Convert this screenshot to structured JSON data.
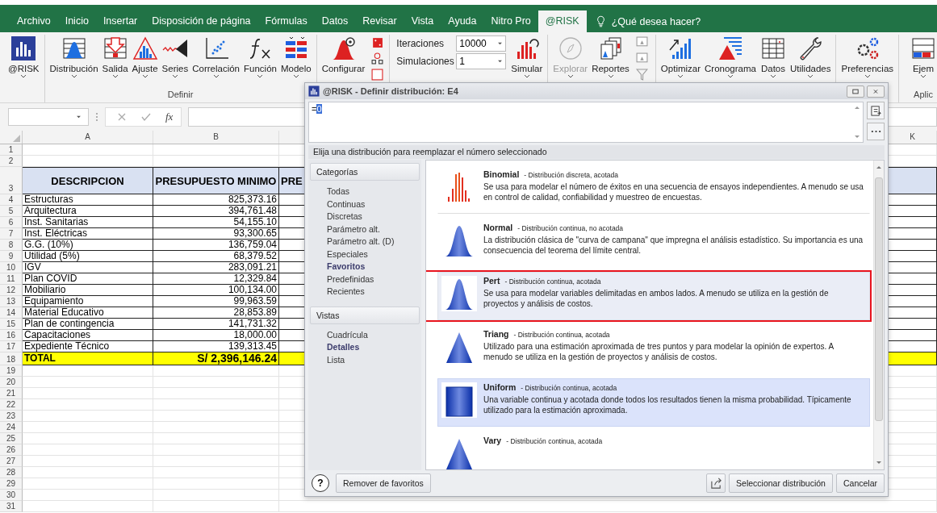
{
  "ribbon_tabs": [
    {
      "label": "Archivo",
      "selected": false
    },
    {
      "label": "Inicio",
      "selected": false
    },
    {
      "label": "Insertar",
      "selected": false
    },
    {
      "label": "Disposición de página",
      "selected": false
    },
    {
      "label": "Fórmulas",
      "selected": false
    },
    {
      "label": "Datos",
      "selected": false
    },
    {
      "label": "Revisar",
      "selected": false
    },
    {
      "label": "Vista",
      "selected": false
    },
    {
      "label": "Ayuda",
      "selected": false
    },
    {
      "label": "Nitro Pro",
      "selected": false
    },
    {
      "label": "@RISK",
      "selected": true
    }
  ],
  "tell_me": "¿Qué desea hacer?",
  "ribbon": {
    "groups": [
      {
        "items": [
          {
            "kind": "logo",
            "label": "@RISK",
            "dropdown": true,
            "disabled": false
          }
        ]
      },
      {
        "label": "Definir",
        "items": [
          {
            "kind": "bell-grid",
            "label": "Distribución",
            "dropdown": true,
            "disabled": false
          },
          {
            "kind": "output",
            "label": "Salida",
            "dropdown": true,
            "disabled": false
          },
          {
            "kind": "fit",
            "label": "Ajuste",
            "dropdown": true,
            "disabled": false
          },
          {
            "kind": "series",
            "label": "Series",
            "dropdown": true,
            "disabled": false
          },
          {
            "kind": "scatter",
            "label": "Correlación",
            "dropdown": true,
            "disabled": false
          },
          {
            "kind": "fx",
            "label": "Función",
            "dropdown": true,
            "disabled": false
          },
          {
            "kind": "model",
            "label": "Modelo",
            "dropdown": true,
            "disabled": false
          }
        ]
      },
      {
        "items": [
          {
            "kind": "config",
            "label": "Configurar",
            "dropdown": false,
            "disabled": false
          },
          {
            "kind": "sim_tools"
          },
          {
            "kind": "fields",
            "fields": [
              {
                "label": "Iteraciones",
                "value": "10000"
              },
              {
                "label": "Simulaciones",
                "value": "1"
              }
            ]
          },
          {
            "kind": "simulate",
            "label": "Simular",
            "dropdown": true,
            "disabled": false
          }
        ]
      },
      {
        "items": [
          {
            "kind": "compass",
            "label": "Explorar",
            "dropdown": true,
            "disabled": true
          },
          {
            "kind": "reports",
            "label": "Reportes",
            "dropdown": true,
            "disabled": false
          },
          {
            "kind": "report_tools"
          }
        ]
      },
      {
        "items": [
          {
            "kind": "optimize",
            "label": "Optimizar",
            "dropdown": true,
            "disabled": false
          },
          {
            "kind": "gantt",
            "label": "Cronograma",
            "dropdown": true,
            "disabled": false
          },
          {
            "kind": "data-grid",
            "label": "Datos",
            "dropdown": true,
            "disabled": false
          },
          {
            "kind": "wrench",
            "label": "Utilidades",
            "dropdown": true,
            "disabled": false
          }
        ]
      },
      {
        "items": [
          {
            "kind": "gears",
            "label": "Preferencias",
            "dropdown": true,
            "disabled": false
          }
        ]
      },
      {
        "label": "Aplic",
        "items": [
          {
            "kind": "partial",
            "label": "Ejem",
            "dropdown": true,
            "disabled": false
          }
        ]
      }
    ]
  },
  "formula_bar": {
    "function_label": "fx"
  },
  "sheet": {
    "columns": [
      "A",
      "B",
      "K"
    ],
    "rows": [
      {
        "number": "1",
        "kind": "empty"
      },
      {
        "number": "2",
        "kind": "empty"
      },
      {
        "number": "3",
        "kind": "header",
        "cells": [
          "DESCRIPCION",
          "PRESUPUESTO MINIMO",
          "PRE"
        ]
      },
      {
        "number": "4",
        "kind": "data",
        "cells": [
          "Estructuras",
          "825,373.16"
        ]
      },
      {
        "number": "5",
        "kind": "data",
        "cells": [
          "Arquitectura",
          "394,761.48"
        ]
      },
      {
        "number": "6",
        "kind": "data",
        "cells": [
          "Inst. Sanitarias",
          "54,155.10"
        ]
      },
      {
        "number": "7",
        "kind": "data",
        "cells": [
          "Inst. Eléctricas",
          "93,300.65"
        ]
      },
      {
        "number": "8",
        "kind": "data",
        "cells": [
          "G.G. (10%)",
          "136,759.04"
        ]
      },
      {
        "number": "9",
        "kind": "data",
        "cells": [
          "Utilidad (5%)",
          "68,379.52"
        ]
      },
      {
        "number": "10",
        "kind": "data",
        "cells": [
          "IGV",
          "283,091.21"
        ]
      },
      {
        "number": "11",
        "kind": "data",
        "cells": [
          "Plan COVID",
          "12,329.84"
        ]
      },
      {
        "number": "12",
        "kind": "data",
        "cells": [
          "Mobiliario",
          "100,134.00"
        ]
      },
      {
        "number": "13",
        "kind": "data",
        "cells": [
          "Equipamiento",
          "99,963.59"
        ]
      },
      {
        "number": "14",
        "kind": "data",
        "cells": [
          "Material Educativo",
          "28,853.89"
        ]
      },
      {
        "number": "15",
        "kind": "data",
        "cells": [
          "Plan de contingencia",
          "141,731.32"
        ]
      },
      {
        "number": "16",
        "kind": "data",
        "cells": [
          "Capacitaciones",
          "18,000.00"
        ]
      },
      {
        "number": "17",
        "kind": "data",
        "cells": [
          "Expediente Técnico",
          "139,313.45"
        ]
      },
      {
        "number": "18",
        "kind": "total",
        "cells": [
          "TOTAL",
          "S/ 2,396,146.24"
        ]
      },
      {
        "number": "19",
        "kind": "empty"
      },
      {
        "number": "20",
        "kind": "empty"
      },
      {
        "number": "21",
        "kind": "empty"
      },
      {
        "number": "22",
        "kind": "empty"
      },
      {
        "number": "23",
        "kind": "empty"
      },
      {
        "number": "24",
        "kind": "empty"
      },
      {
        "number": "25",
        "kind": "empty"
      },
      {
        "number": "26",
        "kind": "empty"
      },
      {
        "number": "27",
        "kind": "empty"
      },
      {
        "number": "28",
        "kind": "empty"
      },
      {
        "number": "29",
        "kind": "empty"
      },
      {
        "number": "30",
        "kind": "empty"
      },
      {
        "number": "31",
        "kind": "empty"
      }
    ]
  },
  "dialog": {
    "title": "@RISK - Definir distribución: E4",
    "formula_prefix": "=",
    "formula_selection": "0",
    "instruction": "Elija una distribución para reemplazar el número seleccionado",
    "sections": [
      {
        "header": "Categorías",
        "items": [
          {
            "label": "Todas",
            "selected": false
          },
          {
            "label": "Continuas",
            "selected": false
          },
          {
            "label": "Discretas",
            "selected": false
          },
          {
            "label": "Parámetro alt.",
            "selected": false
          },
          {
            "label": "Parámetro alt. (D)",
            "selected": false
          },
          {
            "label": "Especiales",
            "selected": false
          },
          {
            "label": "Favoritos",
            "selected": true
          },
          {
            "label": "Predefinidas",
            "selected": false
          },
          {
            "label": "Recientes",
            "selected": false
          }
        ]
      },
      {
        "header": "Vistas",
        "items": [
          {
            "label": "Cuadrícula",
            "selected": false
          },
          {
            "label": "Detalles",
            "selected": true
          },
          {
            "label": "Lista",
            "selected": false
          }
        ]
      }
    ],
    "distributions": [
      {
        "name": "Binomial",
        "summary": "- Distribución discreta, acotada",
        "description": "Se usa para modelar el número de éxitos en una secuencia de ensayos independientes. A menudo se usa en control de calidad, confiabilidad y muestreo de encuestas.",
        "kind": "discrete",
        "selected": false,
        "hovered": false,
        "marked": false
      },
      {
        "name": "Normal",
        "summary": "- Distribución continua, no acotada",
        "description": "La distribución clásica de \"curva de campana\" que impregna el análisis estadístico. Su importancia es una consecuencia del teorema del límite central.",
        "kind": "bell",
        "selected": false,
        "hovered": false,
        "marked": false
      },
      {
        "name": "Pert",
        "summary": "- Distribución continua, acotada",
        "description": "Se usa para modelar variables delimitadas en ambos lados. A menudo se utiliza en la gestión de proyectos y análisis de costos.",
        "kind": "bell",
        "selected": false,
        "hovered": true,
        "marked": true
      },
      {
        "name": "Triang",
        "summary": "- Distribución continua, acotada",
        "description": "Utilizado para una estimación aproximada de tres puntos y para modelar la opinión de expertos. A menudo se utiliza en la gestión de proyectos y análisis de costos.",
        "kind": "triangle",
        "selected": false,
        "hovered": false,
        "marked": false
      },
      {
        "name": "Uniform",
        "summary": "- Distribución continua, acotada",
        "description": "Una variable continua y acotada donde todos los resultados tienen la misma probabilidad. Típicamente utilizado para la estimación aproximada.",
        "kind": "uniform",
        "selected": true,
        "hovered": false,
        "marked": false
      },
      {
        "name": "Vary",
        "summary": "- Distribución continua, acotada",
        "kind": "triangle",
        "selected": false,
        "hovered": false,
        "marked": false
      }
    ],
    "help_button": "?",
    "left_button": "Remover de favoritos",
    "select_button": "Seleccionar distribución",
    "cancel_button": "Cancelar"
  }
}
